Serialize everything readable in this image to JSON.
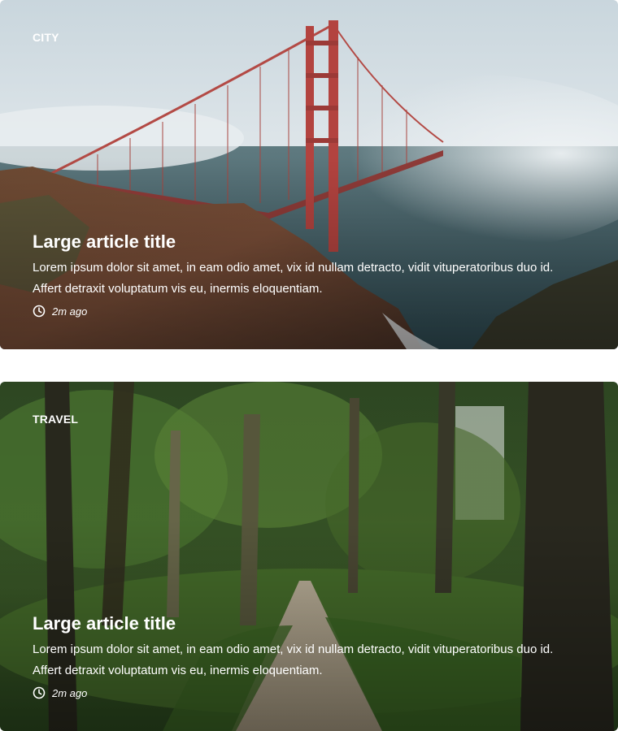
{
  "articles": [
    {
      "category": "CITY",
      "title": "Large article title",
      "excerpt": "Lorem ipsum dolor sit amet, in eam odio amet, vix id nullam detracto, vidit vituperatoribus duo id. Affert detraxit voluptatum vis eu, inermis eloquentiam.",
      "time": "2m ago",
      "icon": "clock-icon"
    },
    {
      "category": "TRAVEL",
      "title": "Large article title",
      "excerpt": "Lorem ipsum dolor sit amet, in eam odio amet, vix id nullam detracto, vidit vituperatoribus duo id. Affert detraxit voluptatum vis eu, inermis eloquentiam.",
      "time": "2m ago",
      "icon": "clock-icon"
    }
  ]
}
